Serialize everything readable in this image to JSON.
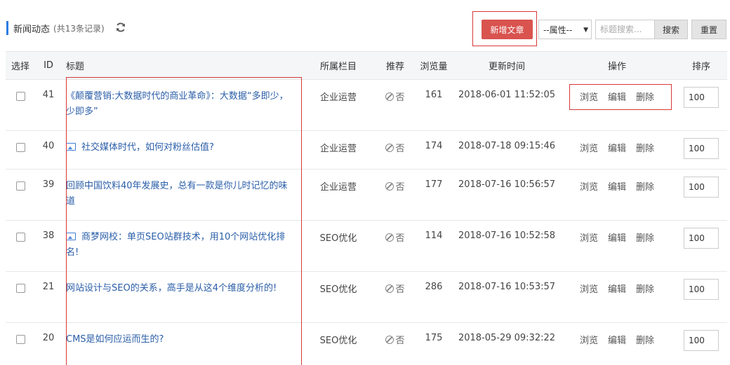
{
  "header": {
    "title": "新闻动态",
    "count": "(共13条记录)",
    "add_button": "新增文章",
    "attr_select": "--属性--",
    "search_placeholder": "标题搜索...",
    "search_button": "搜索",
    "reset_button": "重置"
  },
  "table": {
    "columns": [
      "选择",
      "ID",
      "标题",
      "所属栏目",
      "推荐",
      "浏览量",
      "更新时间",
      "操作",
      "排序"
    ],
    "actions": [
      "浏览",
      "编辑",
      "删除"
    ],
    "rows": [
      {
        "id": "41",
        "title": "《颠覆营销:大数据时代的商业革命》：大数据“多即少，少即多”",
        "has_image": false,
        "category": "企业运营",
        "recommend": "否",
        "views": "161",
        "updated": "2018-06-01 11:52:05",
        "sort": "100"
      },
      {
        "id": "40",
        "title": "社交媒体时代，如何对粉丝估值?",
        "has_image": true,
        "category": "企业运营",
        "recommend": "否",
        "views": "174",
        "updated": "2018-07-18 09:15:46",
        "sort": "100"
      },
      {
        "id": "39",
        "title": "回顾中国饮料40年发展史，总有一款是你儿时记忆的味道",
        "has_image": false,
        "category": "企业运营",
        "recommend": "否",
        "views": "177",
        "updated": "2018-07-16 10:56:57",
        "sort": "100"
      },
      {
        "id": "38",
        "title": "商梦网校：单页SEO站群技术，用10个网站优化排名!",
        "has_image": true,
        "category": "SEO优化",
        "recommend": "否",
        "views": "114",
        "updated": "2018-07-16 10:52:58",
        "sort": "100"
      },
      {
        "id": "21",
        "title": "网站设计与SEO的关系，高手是从这4个维度分析的!",
        "has_image": false,
        "category": "SEO优化",
        "recommend": "否",
        "views": "286",
        "updated": "2018-07-16 10:53:57",
        "sort": "100"
      },
      {
        "id": "20",
        "title": "CMS是如何应运而生的?",
        "has_image": false,
        "category": "SEO优化",
        "recommend": "否",
        "views": "175",
        "updated": "2018-05-29 09:32:22",
        "sort": "100"
      }
    ]
  },
  "colors": {
    "accent": "#2b7de1",
    "danger": "#d9534f",
    "link": "#2a5ea8",
    "highlight_box": "#d9383a"
  }
}
